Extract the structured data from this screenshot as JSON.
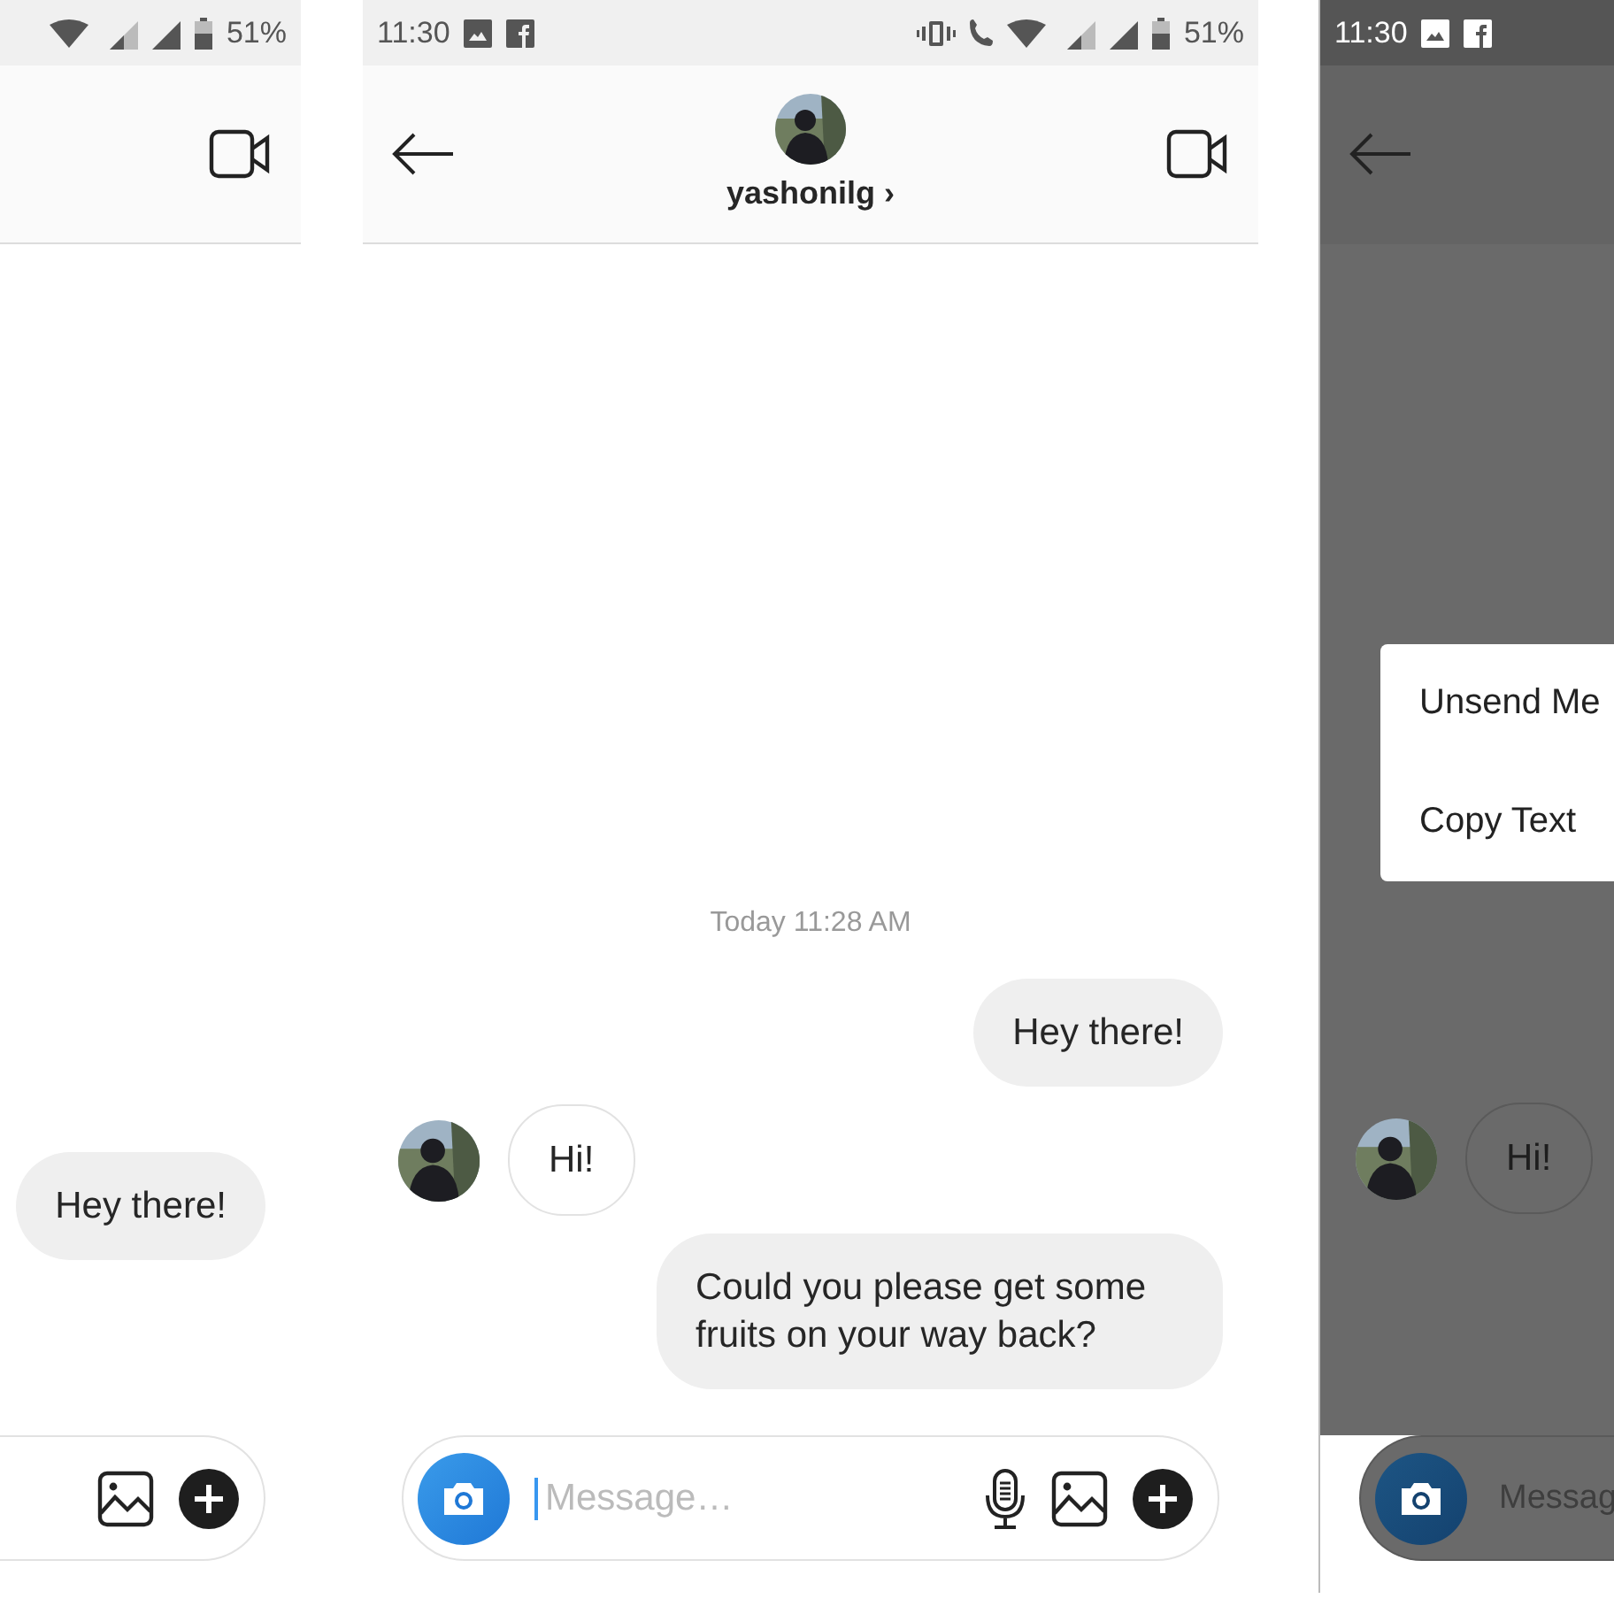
{
  "panels": [
    {
      "kind": "cropped_left",
      "dimmed": false,
      "status_bar": {
        "battery": "51%"
      },
      "messages": [
        {
          "kind": "outgoing",
          "text": "Hey there!"
        }
      ]
    },
    {
      "kind": "full",
      "dimmed": false,
      "status_bar": {
        "time": "11:30",
        "battery": "51%"
      },
      "header": {
        "profile": {
          "username": "yashonilg",
          "chevron": "›"
        }
      },
      "messages": [
        {
          "kind": "timestamp",
          "text": "Today 11:28 AM"
        },
        {
          "kind": "outgoing",
          "text": "Hey there!"
        },
        {
          "kind": "incoming",
          "text": "Hi!"
        },
        {
          "kind": "outgoing",
          "text": "Could you please get some fruits on your way back?"
        }
      ],
      "composer": {
        "focused": true,
        "placeholder": "Message…"
      }
    },
    {
      "kind": "cropped_right",
      "dimmed": true,
      "status_bar": {
        "time": "11:30"
      },
      "messages": [
        {
          "kind": "incoming",
          "text": "Hi!"
        }
      ],
      "menu": [
        "Unsend Me",
        "Copy Text"
      ],
      "composer": {
        "focused": false,
        "placeholder": "Messag"
      }
    }
  ]
}
